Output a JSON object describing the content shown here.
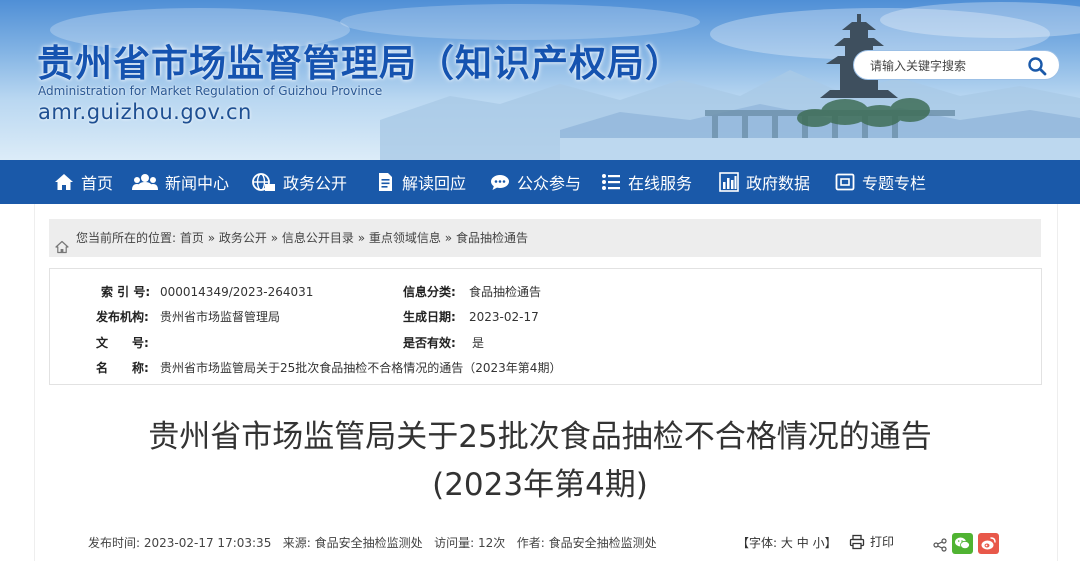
{
  "header": {
    "site_title": "贵州省市场监督管理局（知识产权局）",
    "site_subtitle": "Administration for Market Regulation of Guizhou Province",
    "site_url": "amr.guizhou.gov.cn",
    "search_placeholder": "请输入关键字搜索"
  },
  "nav": {
    "items": [
      {
        "label": "首页",
        "icon": "home-icon"
      },
      {
        "label": "新闻中心",
        "icon": "people-icon"
      },
      {
        "label": "政务公开",
        "icon": "globe-icon"
      },
      {
        "label": "解读回应",
        "icon": "document-icon"
      },
      {
        "label": "公众参与",
        "icon": "chat-icon"
      },
      {
        "label": "在线服务",
        "icon": "list-icon"
      },
      {
        "label": "政府数据",
        "icon": "bar-chart-icon"
      },
      {
        "label": "专题专栏",
        "icon": "window-icon"
      }
    ]
  },
  "breadcrumb": {
    "prefix": "您当前所在的位置:",
    "items": [
      "首页",
      "政务公开",
      "信息公开目录",
      "重点领域信息",
      "食品抽检通告"
    ],
    "separator": "»"
  },
  "info": {
    "index_label": "索 引 号:",
    "index_value": "000014349/2023-264031",
    "category_label": "信息分类:",
    "category_value": "食品抽检通告",
    "publisher_label": "发布机构:",
    "publisher_value": "贵州省市场监督管理局",
    "date_label": "生成日期:",
    "date_value": "2023-02-17",
    "docno_label": "文　　号:",
    "docno_value": "",
    "valid_label": "是否有效:",
    "valid_value": "是",
    "name_label": "名　　称:",
    "name_value": "贵州省市场监管局关于25批次食品抽检不合格情况的通告（2023年第4期）"
  },
  "article": {
    "title_line1": "贵州省市场监管局关于25批次食品抽检不合格情况的通告",
    "title_line2": "(2023年第4期)"
  },
  "meta": {
    "publish_time_label": "发布时间:",
    "publish_time": "2023-02-17 17:03:35",
    "source_label": "来源:",
    "source": "食品安全抽检监测处",
    "views_label": "访问量:",
    "views": "12次",
    "author_label": "作者:",
    "author": "食品安全抽检监测处",
    "font_label": "【字体:",
    "font_large": "大",
    "font_medium": "中",
    "font_small": "小",
    "font_close": "】",
    "print_label": "打印"
  },
  "colors": {
    "nav_bg": "#1a59a9",
    "title_blue": "#1553b0",
    "wechat_green": "#50b332",
    "weibo_red": "#e8584a"
  }
}
